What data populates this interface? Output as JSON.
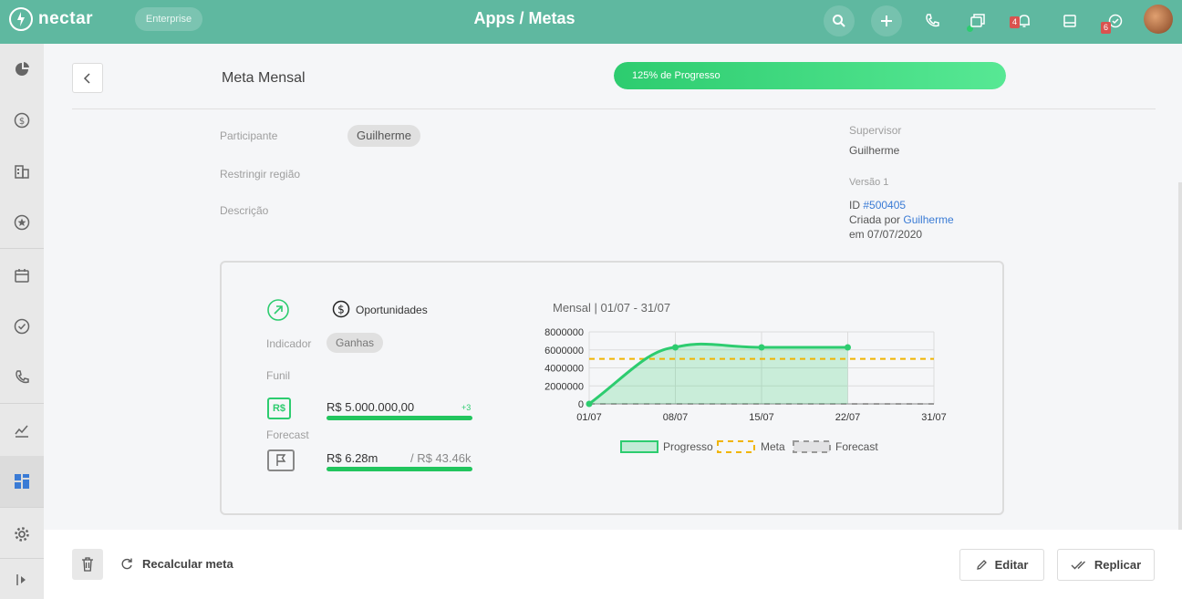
{
  "topbar": {
    "logo": "nectar",
    "plan": "Enterprise",
    "title": "Apps / Metas",
    "icons": [
      "search-icon",
      "plus-icon",
      "phone-icon",
      "chat-icon",
      "bell-icon",
      "inbox-icon",
      "task-check-icon"
    ],
    "badges": {
      "bell": "4",
      "tasks": "6"
    }
  },
  "sidebar": {
    "items": [
      "dashboard-icon",
      "money-icon",
      "building-icon",
      "star-icon",
      "calendar-icon",
      "check-icon",
      "phone-icon",
      "chart-icon",
      "apps-icon",
      "gear-icon",
      "expand-icon"
    ],
    "active": "apps-icon"
  },
  "header": {
    "title": "Meta Mensal",
    "progress_label": "125% de Progresso",
    "progress_value": 1.0
  },
  "details": {
    "participant_label": "Participante",
    "participant_value": "Guilherme",
    "region_label": "Restringir região",
    "description_label": "Descrição",
    "supervisor_label": "Supervisor",
    "supervisor_value": "Guilherme",
    "version": "Versão 1",
    "id_label": "ID",
    "id_value": "#500405",
    "created_by_label": "Criada por",
    "created_by_value": "Guilherme",
    "created_on": "em 07/07/2020"
  },
  "indicator": {
    "entity": "Oportunidades",
    "indicator_label": "Indicador",
    "indicator_value": "Ganhas",
    "funnel_label": "Funil",
    "currency_icon": "R$",
    "goal_value": "R$ 5.000.000,00",
    "goal_delta": "+3",
    "forecast_label": "Forecast",
    "forecast_value": "R$ 6.28m",
    "forecast_total": "/ R$ 43.46k"
  },
  "chart_data": {
    "type": "line",
    "title": "Mensal | 01/07 - 31/07",
    "categories": [
      "01/07",
      "08/07",
      "15/07",
      "22/07",
      "31/07"
    ],
    "ylim": [
      0,
      8000000
    ],
    "yticks": [
      "8000000",
      "6000000",
      "4000000",
      "2000000",
      "0"
    ],
    "series": [
      {
        "name": "Progresso",
        "x": [
          "01/07",
          "08/07",
          "15/07",
          "22/07"
        ],
        "values": [
          0,
          6280000,
          6280000,
          6280000
        ],
        "color": "#2dcc6f"
      },
      {
        "name": "Meta",
        "x": [
          "01/07",
          "31/07"
        ],
        "values": [
          5000000,
          5000000
        ],
        "color": "#f0b400"
      },
      {
        "name": "Forecast",
        "x": [
          "01/07",
          "31/07"
        ],
        "values": [
          0,
          0
        ],
        "color": "#999999"
      }
    ],
    "legend": [
      "Progresso",
      "Meta",
      "Forecast"
    ],
    "legend_position": "bottom",
    "grid": true
  },
  "footer": {
    "recalc_label": "Recalcular meta",
    "edit_label": "Editar",
    "replicate_label": "Replicar"
  }
}
